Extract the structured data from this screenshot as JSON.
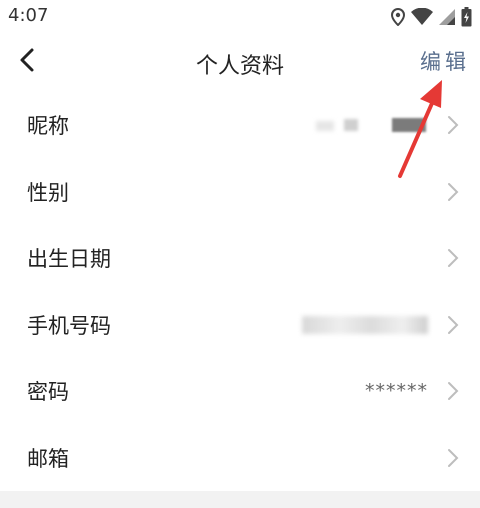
{
  "status_bar": {
    "time": "4:07",
    "icons": [
      "location-icon",
      "wifi-icon",
      "signal-icon",
      "battery-icon"
    ]
  },
  "header": {
    "back_icon": "back-arrow-icon",
    "title": "个人资料",
    "edit_label": "编辑"
  },
  "rows": [
    {
      "label": "昵称",
      "value": "",
      "value_masked": true
    },
    {
      "label": "性别",
      "value": ""
    },
    {
      "label": "出生日期",
      "value": ""
    },
    {
      "label": "手机号码",
      "value": "",
      "value_masked": true
    },
    {
      "label": "密码",
      "value": "******"
    },
    {
      "label": "邮箱",
      "value": ""
    }
  ],
  "colors": {
    "edit": "#5a6f8e",
    "annotation_arrow": "#e53935",
    "chevron": "#bdbdbd"
  }
}
